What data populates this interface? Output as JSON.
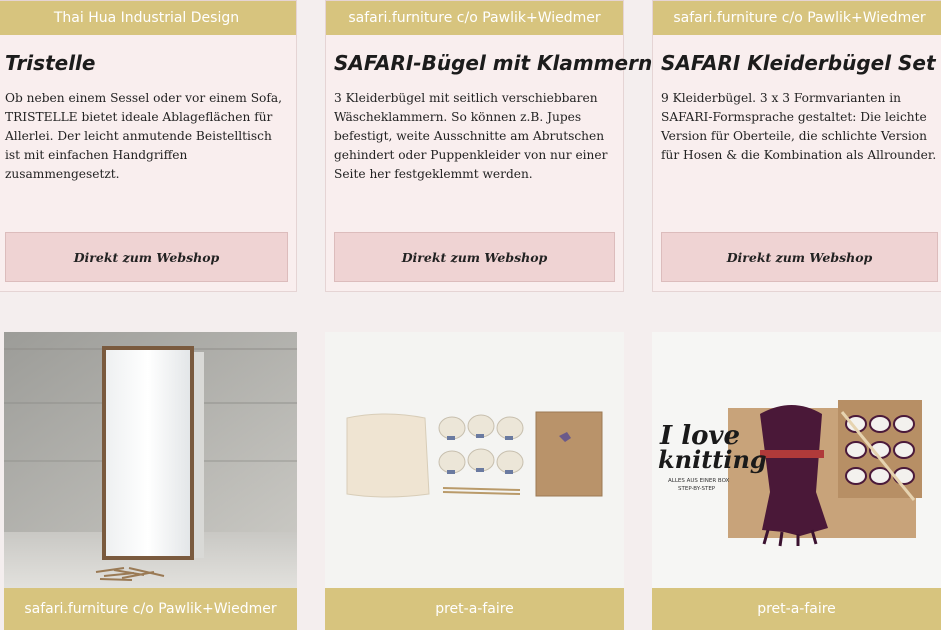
{
  "products": [
    {
      "vendor": "Thai Hua Industrial Design",
      "title": "Tristelle",
      "description": "Ob neben einem Sessel oder vor einem Sofa, TRISTELLE bietet ideale Ablageflächen für Allerlei. Der leicht anmutende Beistelltisch ist mit einfachen Handgriffen zusammengesetzt.",
      "button": "Direkt zum Webshop"
    },
    {
      "vendor": "safari.furniture c/o Pawlik+Wiedmer",
      "title": "SAFARI-Bügel mit Klammern",
      "description": "3 Kleiderbügel mit seitlich verschiebbaren Wäscheklammern. So können z.B. Jupes befestigt, weite Ausschnitte am Abrutschen gehindert oder Puppenkleider von nur einer Seite her festgeklemmt werden.",
      "button": "Direkt zum Webshop"
    },
    {
      "vendor": "safari.furniture c/o Pawlik+Wiedmer",
      "title": "SAFARI Kleiderbügel Set",
      "description": "9 Kleiderbügel. 3 x 3 Formvarianten in SAFARI-Formsprache gestaltet: Die leichte Version für Oberteile, die schlichte Version für Hosen & die Kombination als Allrounder.",
      "button": "Direkt zum Webshop"
    }
  ],
  "image_cards": [
    {
      "vendor": "safari.furniture c/o Pawlik+Wiedmer"
    },
    {
      "vendor": "pret-a-faire"
    },
    {
      "vendor": "pret-a-faire",
      "overlay_line1": "I love",
      "overlay_line2": "knitting",
      "overlay_sub1": "ALLES AUS EINER BOX",
      "overlay_sub2": "STEP-BY-STEP"
    }
  ],
  "colors": {
    "accent_gold": "#d7c47e",
    "card_bg": "#f9eeee",
    "button_bg": "#efd3d3"
  }
}
